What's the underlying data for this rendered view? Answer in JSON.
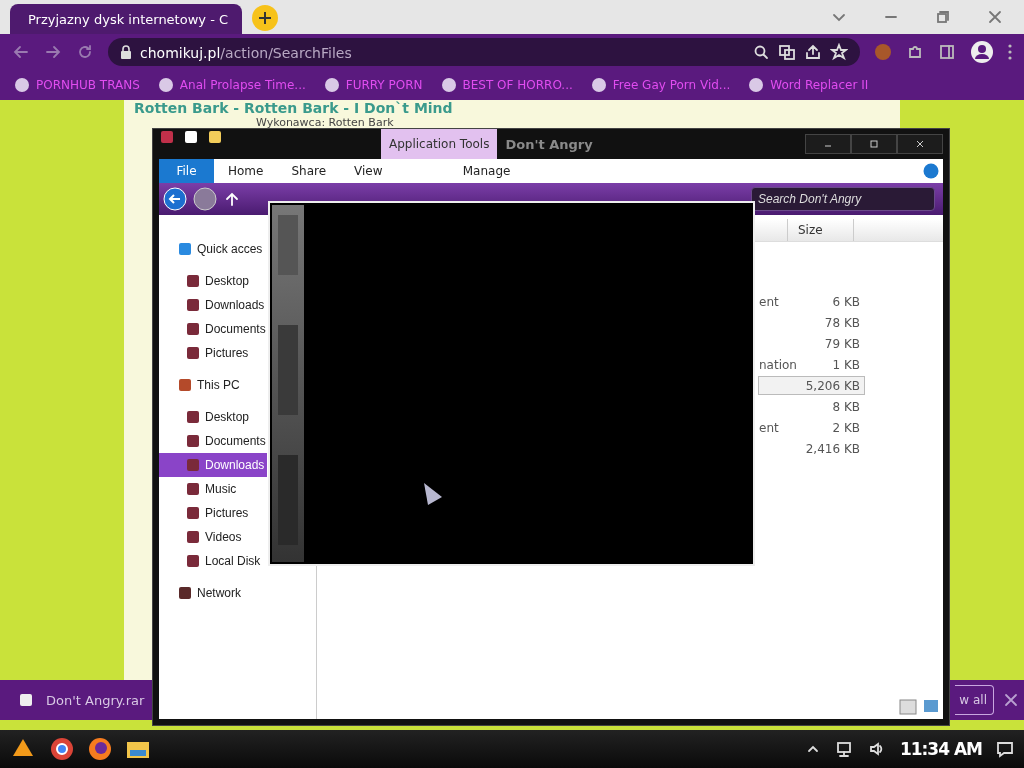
{
  "browser": {
    "tab": {
      "title": "Przyjazny dysk internetowy - C",
      "selected": true
    },
    "url_host": "chomikuj.pl",
    "url_path": "/action/SearchFiles",
    "bookmarks": [
      "PORNHUB TRANS",
      "Anal Prolapse Time...",
      "FURRY PORN",
      "BEST OF HORRO...",
      "Free Gay Porn Vid...",
      "Word Replacer II"
    ]
  },
  "page": {
    "heading": "Rotten Bark - Rotten Bark - I Don`t Mind",
    "artist": "Wykonawca: Rotten Bark"
  },
  "explorer": {
    "title": "Don't Angry",
    "context_tab": "Application Tools",
    "ribbon_tabs": [
      {
        "label": "File",
        "selected": true
      },
      {
        "label": "Home",
        "selected": false
      },
      {
        "label": "Share",
        "selected": false
      },
      {
        "label": "View",
        "selected": false
      },
      {
        "label": "Manage",
        "selected": false
      }
    ],
    "search_placeholder": "Search Don't Angry",
    "nav": [
      {
        "label": "Quick acces",
        "selected": false,
        "children": [
          {
            "label": "Desktop",
            "selected": false
          },
          {
            "label": "Downloads",
            "selected": false
          },
          {
            "label": "Documents",
            "selected": false
          },
          {
            "label": "Pictures",
            "selected": false
          }
        ]
      },
      {
        "label": "This PC",
        "selected": false,
        "children": [
          {
            "label": "Desktop",
            "selected": false
          },
          {
            "label": "Documents",
            "selected": false
          },
          {
            "label": "Downloads",
            "selected": true
          },
          {
            "label": "Music",
            "selected": false
          },
          {
            "label": "Pictures",
            "selected": false
          },
          {
            "label": "Videos",
            "selected": false
          },
          {
            "label": "Local Disk",
            "selected": false
          }
        ]
      },
      {
        "label": "Network",
        "selected": false
      }
    ],
    "size_column": "Size",
    "rows": [
      {
        "type": "ent",
        "size": "6 KB",
        "selected": false
      },
      {
        "size": "78 KB",
        "selected": false
      },
      {
        "size": "79 KB",
        "selected": false
      },
      {
        "type": "nation",
        "size": "1 KB",
        "selected": false
      },
      {
        "size": "5,206 KB",
        "selected": true
      },
      {
        "size": "8 KB",
        "selected": false
      },
      {
        "type": "ent",
        "size": "2 KB",
        "selected": false
      },
      {
        "size": "2,416 KB",
        "selected": false
      }
    ]
  },
  "download_bar": {
    "file": "Don't Angry.rar",
    "show_all": "w all"
  },
  "taskbar": {
    "time": "11:34 AM"
  }
}
